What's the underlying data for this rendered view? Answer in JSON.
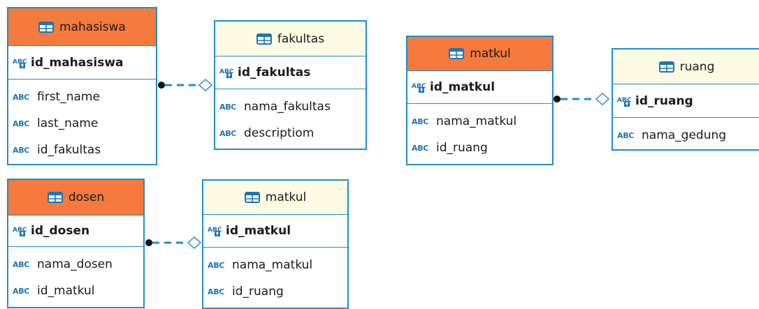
{
  "colors": {
    "border": "#1f8fc8",
    "header_primary": "#f47a3d",
    "header_secondary": "#fdfbe3",
    "type_icon": "#1976b8",
    "connector": "#1f8fc8"
  },
  "type_icon_text": "ABC",
  "entities": [
    {
      "id": "mahasiswa",
      "title": "mahasiswa",
      "header_style": "orange",
      "pk": "id_mahasiswa",
      "columns": [
        "first_name",
        "last_name",
        "id_fakultas"
      ]
    },
    {
      "id": "fakultas",
      "title": "fakultas",
      "header_style": "cream",
      "pk": "id_fakultas",
      "columns": [
        "nama_fakultas",
        "descriptiom"
      ]
    },
    {
      "id": "matkul_1",
      "title": "matkul",
      "header_style": "orange",
      "pk": "id_matkul",
      "columns": [
        "nama_matkul",
        "id_ruang"
      ]
    },
    {
      "id": "ruang",
      "title": "ruang",
      "header_style": "cream",
      "pk": "id_ruang",
      "columns": [
        "nama_gedung"
      ]
    },
    {
      "id": "dosen",
      "title": "dosen",
      "header_style": "orange",
      "pk": "id_dosen",
      "columns": [
        "nama_dosen",
        "id_matkul"
      ]
    },
    {
      "id": "matkul_2",
      "title": "matkul",
      "header_style": "cream",
      "pk": "id_matkul",
      "columns": [
        "nama_matkul",
        "id_ruang"
      ]
    }
  ],
  "relationships": [
    {
      "from": "mahasiswa",
      "to": "fakultas",
      "style": "dashed"
    },
    {
      "from": "matkul_1",
      "to": "ruang",
      "style": "dashed"
    },
    {
      "from": "dosen",
      "to": "matkul_2",
      "style": "dashed"
    }
  ]
}
